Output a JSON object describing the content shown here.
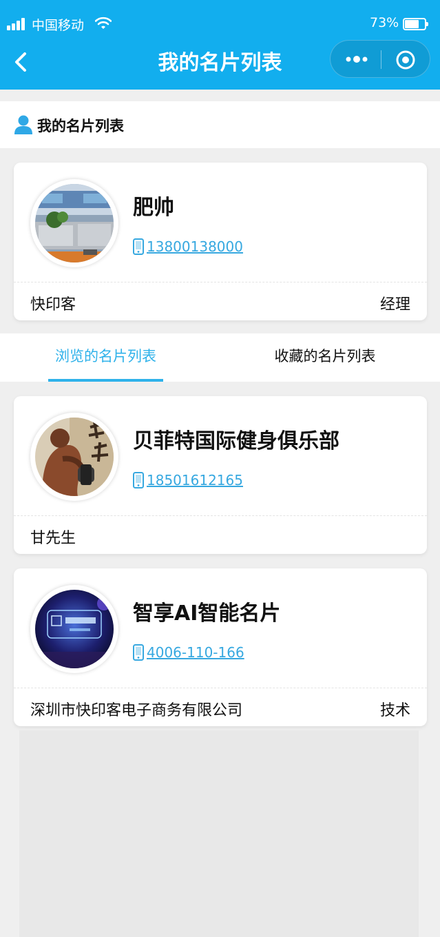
{
  "status_bar": {
    "carrier": "中国移动",
    "battery_percent": "73%",
    "battery_level": 0.73
  },
  "nav": {
    "title": "我的名片列表"
  },
  "my_section": {
    "label": "我的名片列表",
    "card": {
      "name": "肥帅",
      "phone": "13800138000",
      "company": "快印客",
      "title": "经理"
    }
  },
  "tabs": [
    {
      "label": "浏览的名片列表",
      "active": true
    },
    {
      "label": "收藏的名片列表",
      "active": false
    }
  ],
  "browsed_cards": [
    {
      "name": "贝菲特国际健身俱乐部",
      "phone": "18501612165",
      "company": "甘先生",
      "title": ""
    },
    {
      "name": "智享AI智能名片",
      "phone": "4006-110-166",
      "company": "深圳市快印客电子商务有限公司",
      "title": "技术"
    }
  ],
  "colors": {
    "brand": "#12aeee",
    "accent": "#2fb2ea",
    "link": "#36a8e0"
  }
}
